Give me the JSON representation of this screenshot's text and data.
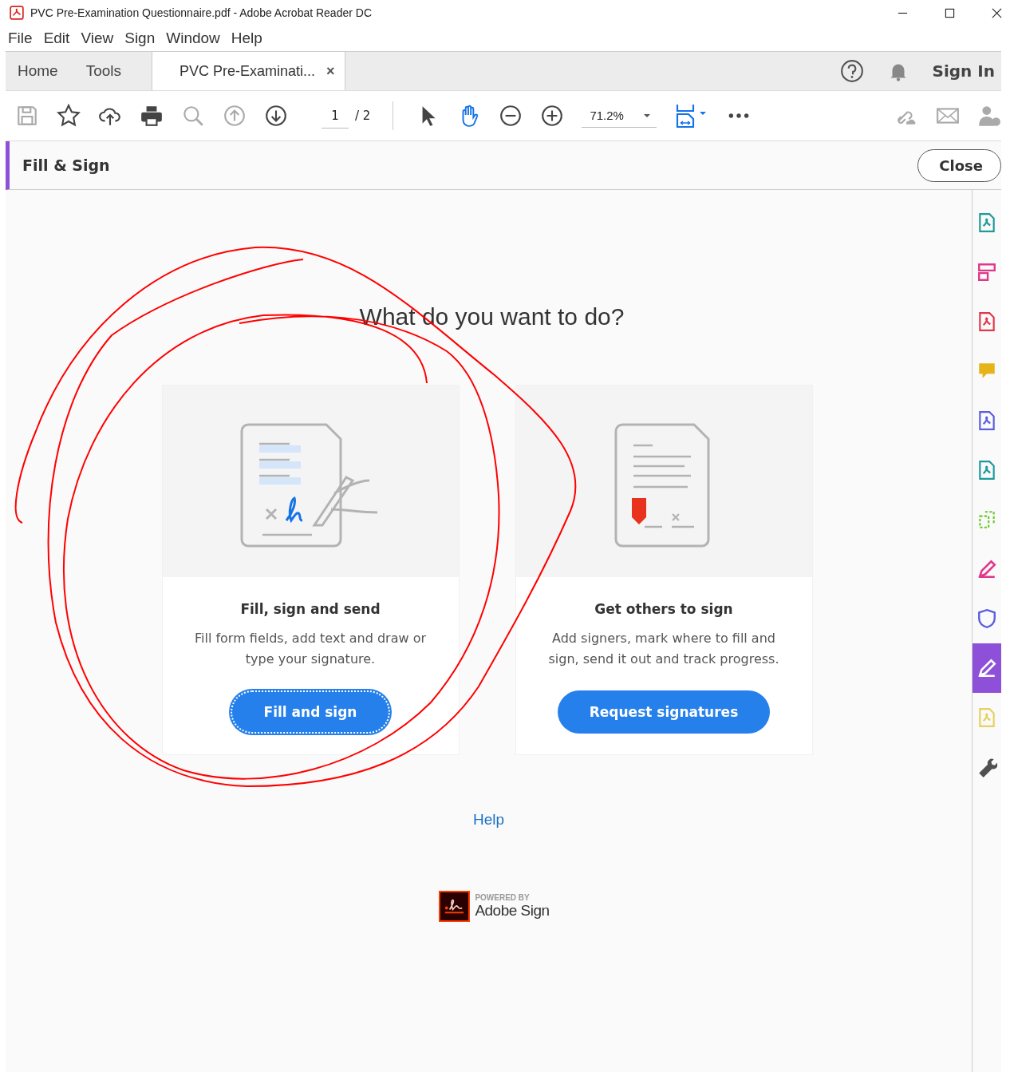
{
  "window": {
    "title": "PVC Pre-Examination Questionnaire.pdf - Adobe Acrobat Reader DC"
  },
  "menu": [
    "File",
    "Edit",
    "View",
    "Sign",
    "Window",
    "Help"
  ],
  "tabs": [
    {
      "kind": "nav",
      "label": "Home",
      "selected": false
    },
    {
      "kind": "nav",
      "label": "Tools",
      "selected": false
    },
    {
      "kind": "document",
      "label": "PVC Pre-Examinati...",
      "selected": true,
      "close_glyph": "×"
    }
  ],
  "sign_in": "Sign In",
  "toolbar": {
    "page": "1",
    "page_total": "/ 2",
    "zoom": "71.2%"
  },
  "panel": {
    "title": "Fill & Sign",
    "close": "Close"
  },
  "heading": "What do you want to do?",
  "cards": [
    {
      "kind": "fill",
      "title": "Fill, sign and send",
      "description": "Fill form fields, add text and draw or type your signature.",
      "button": "Fill and sign",
      "focused": true
    },
    {
      "kind": "request",
      "title": "Get others to sign",
      "description": "Add signers, mark where to fill and sign, send it out and track progress.",
      "button": "Request signatures",
      "focused": false
    }
  ],
  "help": "Help",
  "logo": {
    "powered_by": "POWERED BY",
    "brand": "Adobe Sign"
  },
  "sidebar_tools": [
    {
      "kind": "export",
      "color": "#1d9a9a",
      "selected": false
    },
    {
      "kind": "form",
      "color": "#e0368c",
      "selected": false
    },
    {
      "kind": "pdf",
      "color": "#e3374a",
      "selected": false
    },
    {
      "kind": "comment",
      "color": "#e6b418",
      "selected": false
    },
    {
      "kind": "combine",
      "color": "#5a5ee0",
      "selected": false
    },
    {
      "kind": "organize",
      "color": "#1d9a9a",
      "selected": false
    },
    {
      "kind": "crop",
      "color": "#6cc82a",
      "selected": false
    },
    {
      "kind": "edit",
      "color": "#e0368c",
      "selected": false
    },
    {
      "kind": "protect",
      "color": "#5a5ee0",
      "selected": false
    },
    {
      "kind": "sign",
      "color": "#ffffff",
      "selected": true
    },
    {
      "kind": "file",
      "color": "#e6d060",
      "selected": false
    },
    {
      "kind": "tools",
      "color": "#505050",
      "selected": false
    }
  ]
}
